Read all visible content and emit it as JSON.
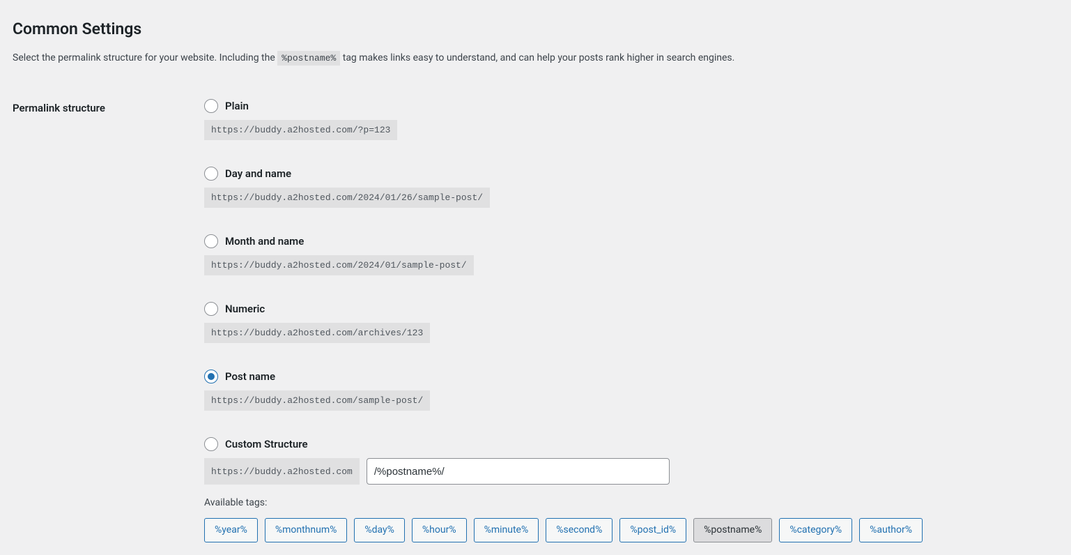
{
  "heading": "Common Settings",
  "description": {
    "before": "Select the permalink structure for your website. Including the ",
    "code": "%postname%",
    "after": " tag makes links easy to understand, and can help your posts rank higher in search engines."
  },
  "field_label": "Permalink structure",
  "options": [
    {
      "label": "Plain",
      "example": "https://buddy.a2hosted.com/?p=123",
      "checked": false
    },
    {
      "label": "Day and name",
      "example": "https://buddy.a2hosted.com/2024/01/26/sample-post/",
      "checked": false
    },
    {
      "label": "Month and name",
      "example": "https://buddy.a2hosted.com/2024/01/sample-post/",
      "checked": false
    },
    {
      "label": "Numeric",
      "example": "https://buddy.a2hosted.com/archives/123",
      "checked": false
    },
    {
      "label": "Post name",
      "example": "https://buddy.a2hosted.com/sample-post/",
      "checked": true
    }
  ],
  "custom": {
    "label": "Custom Structure",
    "base": "https://buddy.a2hosted.com",
    "value": "/%postname%/",
    "checked": false
  },
  "available_tags_label": "Available tags:",
  "tags": [
    {
      "text": "%year%",
      "active": false
    },
    {
      "text": "%monthnum%",
      "active": false
    },
    {
      "text": "%day%",
      "active": false
    },
    {
      "text": "%hour%",
      "active": false
    },
    {
      "text": "%minute%",
      "active": false
    },
    {
      "text": "%second%",
      "active": false
    },
    {
      "text": "%post_id%",
      "active": false
    },
    {
      "text": "%postname%",
      "active": true
    },
    {
      "text": "%category%",
      "active": false
    },
    {
      "text": "%author%",
      "active": false
    }
  ]
}
